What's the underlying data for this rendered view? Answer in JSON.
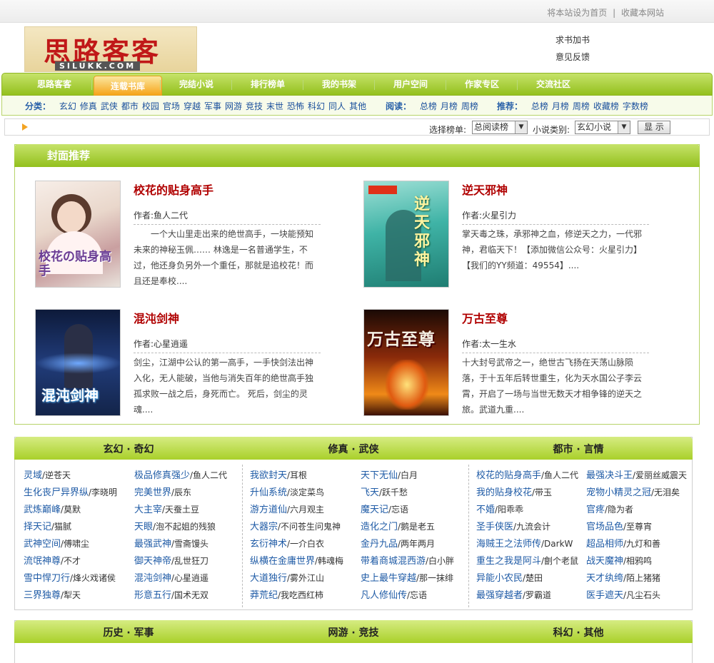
{
  "top_links": {
    "set_home": "将本站设为首页",
    "sep": "|",
    "bookmark": "收藏本网站"
  },
  "logo": {
    "cn": "思路客客",
    "en": "SILUKK.COM"
  },
  "header_links": [
    "求书加书",
    "意见反馈"
  ],
  "nav": [
    "思路客客",
    "连载书库",
    "完结小说",
    "排行榜单",
    "我的书架",
    "用户空间",
    "作家专区",
    "交流社区"
  ],
  "nav_active": 1,
  "subnav": {
    "category_label": "分类：",
    "categories": [
      "玄幻",
      "修真",
      "武侠",
      "都市",
      "校园",
      "官场",
      "穿越",
      "军事",
      "网游",
      "竞技",
      "末世",
      "恐怖",
      "科幻",
      "同人",
      "其他"
    ],
    "read_label": "阅读：",
    "read": [
      "总榜",
      "月榜",
      "周榜"
    ],
    "recommend_label": "推荐：",
    "recommend": [
      "总榜",
      "月榜",
      "周榜",
      "收藏榜",
      "字数榜"
    ]
  },
  "filter": {
    "rank_label": "选择榜单:",
    "rank_value": "总阅读榜",
    "type_label": "小说类别:",
    "type_value": "玄幻小说",
    "button": "显 示"
  },
  "cover_section": {
    "title": "封面推荐",
    "books": [
      {
        "title": "校花的贴身高手",
        "author": "作者:鱼人二代",
        "desc": "　　一个大山里走出来的绝世高手，一块能预知未来的神秘玉佩…… 林逸是一名普通学生，不过，他还身负另外一个重任，那就是追校花！而且还是奉校....",
        "cover_text": "校花の贴身高手"
      },
      {
        "title": "逆天邪神",
        "author": "作者:火星引力",
        "desc": "掌天毒之珠，承邪神之血，修逆天之力，一代邪神，君临天下！【添加微信公众号：火星引力】【我们的YY频道：49554】....",
        "cover_text": "逆天邪神"
      },
      {
        "title": "混沌剑神",
        "author": "作者:心星逍遥",
        "desc": "剑尘，江湖中公认的第一高手，一手快剑法出神入化，无人能破，当他与消失百年的绝世高手独孤求败一战之后，身死而亡。 死后，剑尘的灵魂....",
        "cover_text": "混沌剑神"
      },
      {
        "title": "万古至尊",
        "author": "作者:太一生水",
        "desc": "十大封号武帝之一，绝世古飞扬在天荡山脉陨落，于十五年后转世重生，化为天水国公子李云霄，开启了一场与当世无数天才相争锋的逆天之旅。武道九重....",
        "cover_text": "万古至尊"
      }
    ]
  },
  "category_blocks": [
    {
      "headers": [
        "玄幻 · 奇幻",
        "修真 · 武侠",
        "都市 · 言情"
      ],
      "columns": [
        [
          [
            [
              "灵域",
              "/逆苍天"
            ],
            [
              "生化丧尸异界纵",
              "/李晓明"
            ],
            [
              "武炼巅峰",
              "/莫默"
            ],
            [
              "择天记",
              "/猫腻"
            ],
            [
              "武神空间",
              "/傅啸尘"
            ],
            [
              "流氓神尊",
              "/不才"
            ],
            [
              "雪中悍刀行",
              "/烽火戏诸侯"
            ],
            [
              "三界独尊",
              "/犁天"
            ]
          ],
          [
            [
              "极品修真强少",
              "/鱼人二代"
            ],
            [
              "完美世界",
              "/辰东"
            ],
            [
              "大主宰",
              "/天蚕土豆"
            ],
            [
              "天眼",
              "/泡不起姐的残狼"
            ],
            [
              "最强武神",
              "/雪斋馒头"
            ],
            [
              "御天神帝",
              "/乱世狂刀"
            ],
            [
              "混沌剑神",
              "/心星逍遥"
            ],
            [
              "形意五行",
              "/国术无双"
            ]
          ]
        ],
        [
          [
            [
              "我欲封天",
              "/耳根"
            ],
            [
              "升仙系统",
              "/淡定菜鸟"
            ],
            [
              "游方道仙",
              "/六月观主"
            ],
            [
              "大器宗",
              "/不问苍生问鬼神"
            ],
            [
              "玄衍神术",
              "/一介白衣"
            ],
            [
              "纵横在金庸世界",
              "/韩魂梅"
            ],
            [
              "大道独行",
              "/雾外江山"
            ],
            [
              "莽荒纪",
              "/我吃西红柿"
            ]
          ],
          [
            [
              "天下无仙",
              "/白月"
            ],
            [
              "飞天",
              "/跃千愁"
            ],
            [
              "魔天记",
              "/忘语"
            ],
            [
              "造化之门",
              "/鹅是老五"
            ],
            [
              "金丹九品",
              "/两年两月"
            ],
            [
              "带着商城混西游",
              "/白小胖"
            ],
            [
              "史上最牛穿越",
              "/那一抹绯"
            ],
            [
              "凡人修仙传",
              "/忘语"
            ]
          ]
        ],
        [
          [
            [
              "校花的贴身高手",
              "/鱼人二代"
            ],
            [
              "我的贴身校花",
              "/带玉"
            ],
            [
              "不婚",
              "/阳乖乖"
            ],
            [
              "圣手侠医",
              "/九流会计"
            ],
            [
              "海贼王之法师传",
              "/DarkW"
            ],
            [
              "重生之我是阿斗",
              "/劊个老鼠"
            ],
            [
              "异能小农民",
              "/楚田"
            ],
            [
              "最强穿越者",
              "/罗霸道"
            ]
          ],
          [
            [
              "最强决斗王",
              "/爱丽丝威震天"
            ],
            [
              "宠物小精灵之冠",
              "/无泪矣"
            ],
            [
              "官疼",
              "/隐为者"
            ],
            [
              "官场品色",
              "/至尊宵"
            ],
            [
              "超品相师",
              "/九灯和善"
            ],
            [
              "战天魔神",
              "/相鸦鸣"
            ],
            [
              "天才纨绔",
              "/陌上猪猪"
            ],
            [
              "医手遮天",
              "/凡尘石头"
            ]
          ]
        ]
      ]
    },
    {
      "headers": [
        "历史 · 军事",
        "网游 · 竞技",
        "科幻 · 其他"
      ],
      "columns": []
    }
  ],
  "colors": {
    "nav_green": "#93c01d",
    "link_blue": "#1f5ba6",
    "title_red": "#b00000",
    "active_orange": "#f6a41a"
  }
}
